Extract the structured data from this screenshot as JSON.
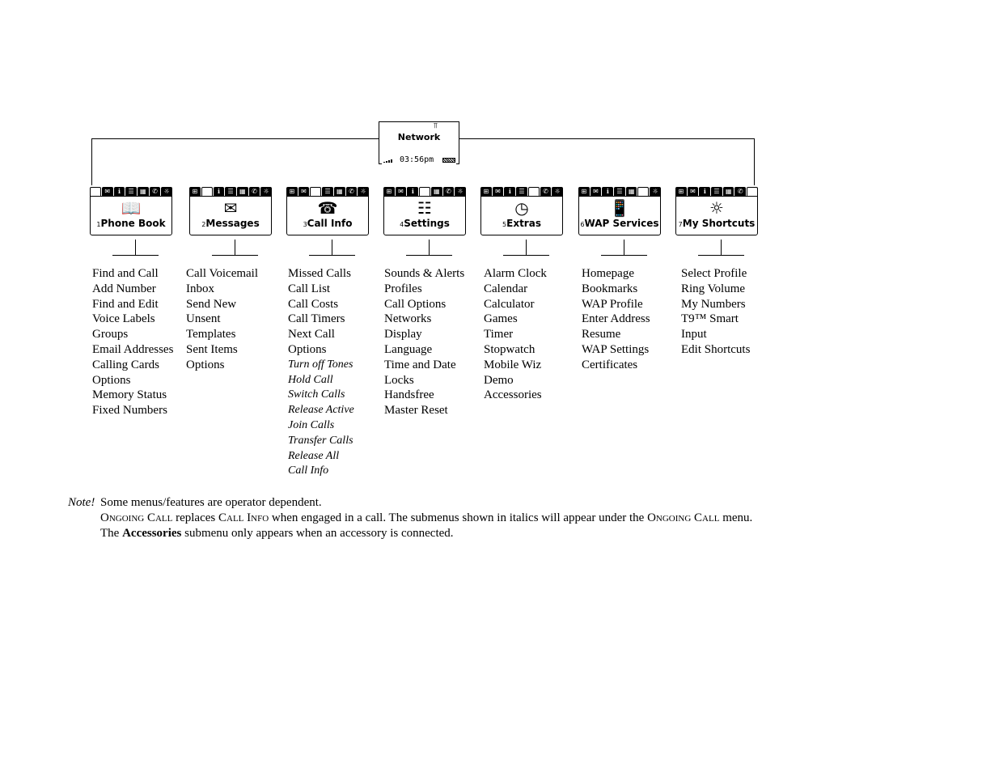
{
  "idle_screen": {
    "title": "Network",
    "time": "03:56pm",
    "antenna_icon": "antenna-icon",
    "signal_icon": "signal-strength-icon",
    "battery_icon": "battery-icon"
  },
  "tab_icons": [
    {
      "name": "phonebook-tab-icon",
      "glyph": "⊞"
    },
    {
      "name": "messages-tab-icon",
      "glyph": "✉"
    },
    {
      "name": "callinfo-tab-icon",
      "glyph": "ℹ"
    },
    {
      "name": "settings-tab-icon",
      "glyph": "☰"
    },
    {
      "name": "extras-tab-icon",
      "glyph": "▦"
    },
    {
      "name": "wap-tab-icon",
      "glyph": "✆"
    },
    {
      "name": "shortcuts-tab-icon",
      "glyph": "☼"
    }
  ],
  "menus": [
    {
      "number": "1",
      "label": "Phone Book",
      "icon": "phone-book-icon",
      "glyph": "📖",
      "items": [
        "Find and Call",
        "Add Number",
        "Find and Edit",
        "Voice Labels",
        "Groups",
        "Email Addresses",
        "Calling Cards",
        "Options",
        "Memory Status",
        "Fixed Numbers"
      ],
      "italic_items": []
    },
    {
      "number": "2",
      "label": "Messages",
      "icon": "envelope-icon",
      "glyph": "✉",
      "items": [
        "Call Voicemail",
        "Inbox",
        "Send New",
        "Unsent",
        "Templates",
        "Sent Items",
        "Options"
      ],
      "italic_items": []
    },
    {
      "number": "3",
      "label": "Call Info",
      "icon": "call-info-icon",
      "glyph": "☎",
      "items": [
        "Missed Calls",
        "Call List",
        "Call Costs",
        "Call Timers",
        "Next Call",
        "Options"
      ],
      "italic_items": [
        "Turn off Tones",
        "Hold Call",
        "Switch Calls",
        "Release Active",
        "Join Calls",
        "Transfer Calls",
        "Release All",
        "Call Info"
      ]
    },
    {
      "number": "4",
      "label": "Settings",
      "icon": "settings-icon",
      "glyph": "☷",
      "items": [
        "Sounds & Alerts",
        "Profiles",
        "Call Options",
        "Networks",
        "Display",
        "Language",
        "Time and Date",
        "Locks",
        "Handsfree",
        "Master Reset"
      ],
      "italic_items": []
    },
    {
      "number": "5",
      "label": "Extras",
      "icon": "extras-clock-calculator-icon",
      "glyph": "◷",
      "items": [
        "Alarm Clock",
        "Calendar",
        "Calculator",
        "Games",
        "Timer",
        "Stopwatch",
        "Mobile Wiz",
        "Demo",
        "Accessories"
      ],
      "italic_items": []
    },
    {
      "number": "6",
      "label": "WAP Services",
      "icon": "wap-phone-icon",
      "glyph": "📱",
      "items": [
        "Homepage",
        "Bookmarks",
        "WAP Profile",
        "Enter Address",
        "Resume",
        "WAP Settings",
        "Certificates"
      ],
      "italic_items": []
    },
    {
      "number": "7",
      "label": "My Shortcuts",
      "icon": "sun-shortcut-icon",
      "glyph": "☼",
      "items": [
        "Select Profile",
        "Ring Volume",
        "My Numbers",
        "T9™ Smart",
        "Input",
        "Edit Shortcuts"
      ],
      "italic_items": []
    }
  ],
  "notes": {
    "label": "Note!",
    "line1": "Some menus/features are operator dependent.",
    "line2_part1": "Ongoing Call",
    "line2_part2": " replaces ",
    "line2_part3": "Call Info",
    "line2_part4": " when engaged in a call. The submenus shown in italics will appear under the ",
    "line2_part5": "Ongoing Call",
    "line2_part6": " menu.",
    "line3_part1": "The ",
    "line3_part2": "Accessories",
    "line3_part3": " submenu only appears when an accessory is connected."
  }
}
